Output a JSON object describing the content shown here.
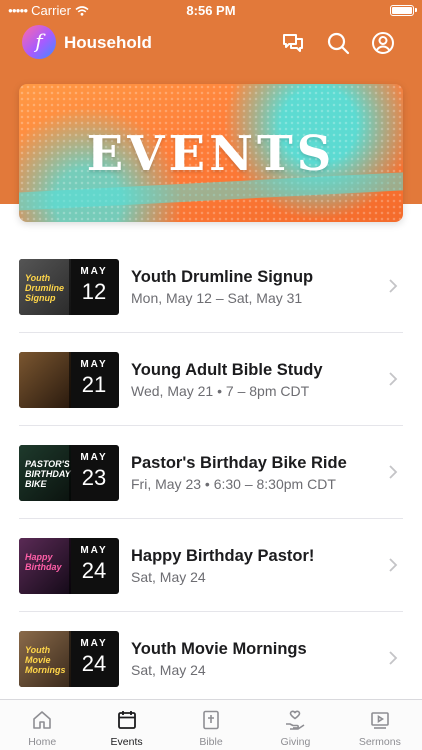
{
  "status_bar": {
    "carrier": "Carrier",
    "time": "8:56 PM"
  },
  "header": {
    "title": "Household",
    "logo_glyph": "f",
    "icons": [
      "chat-icon",
      "search-icon",
      "account-icon"
    ]
  },
  "banner": {
    "title": "EVENTS"
  },
  "events": [
    {
      "title": "Youth Drumline Signup",
      "subtitle": "Mon, May 12 – Sat, May 31",
      "month": "MAY",
      "day": "12",
      "thumb_label": "Youth Drumline Signup",
      "thumb_color": "#3b3b3b"
    },
    {
      "title": "Young Adult Bible Study",
      "subtitle": "Wed, May 21 • 7 – 8pm CDT",
      "month": "MAY",
      "day": "21",
      "thumb_label": "",
      "thumb_color": "#5a3b22"
    },
    {
      "title": "Pastor's Birthday Bike Ride",
      "subtitle": "Fri, May 23 • 6:30 – 8:30pm CDT",
      "month": "MAY",
      "day": "23",
      "thumb_label": "PASTOR'S BIRTHDAY BIKE",
      "thumb_color": "#1b2a22"
    },
    {
      "title": "Happy Birthday Pastor!",
      "subtitle": "Sat, May 24",
      "month": "MAY",
      "day": "24",
      "thumb_label": "Happy Birthday",
      "thumb_color": "#2a1a30"
    },
    {
      "title": "Youth Movie Mornings",
      "subtitle": "Sat, May 24",
      "month": "MAY",
      "day": "24",
      "thumb_label": "Youth Movie Mornings",
      "thumb_color": "#4a3a2a"
    }
  ],
  "tabs": [
    {
      "label": "Home",
      "icon": "home-icon",
      "active": false
    },
    {
      "label": "Events",
      "icon": "calendar-icon",
      "active": true
    },
    {
      "label": "Bible",
      "icon": "bible-icon",
      "active": false
    },
    {
      "label": "Giving",
      "icon": "giving-icon",
      "active": false
    },
    {
      "label": "Sermons",
      "icon": "sermons-icon",
      "active": false
    }
  ],
  "colors": {
    "accent": "#e2793a",
    "banner_teal": "#54e0da",
    "text": "#1c1c1e",
    "muted": "#6d6d72"
  }
}
